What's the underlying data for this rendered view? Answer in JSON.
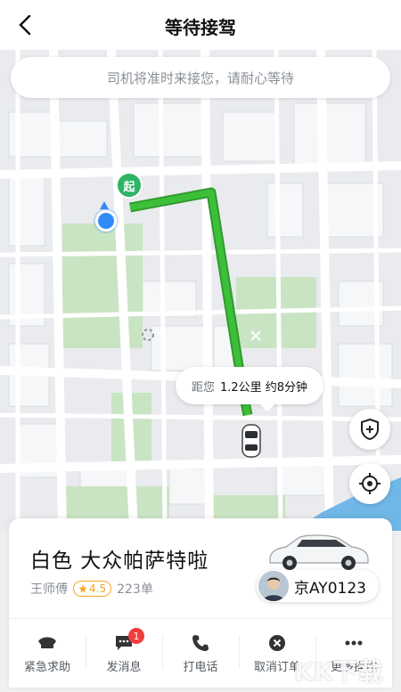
{
  "header": {
    "title": "等待接驾"
  },
  "map": {
    "notice": "司机将准时来接您，请耐心等待",
    "start_label": "起",
    "eta_bubble": {
      "prefix": "距您",
      "distance_time": "1.2公里 约8分钟"
    },
    "route_color": "#3dbf3a",
    "road_color": "#ffffff",
    "park_color": "#c9e4c3",
    "water_color": "#6fb7e6"
  },
  "car": {
    "name": "白色 大众帕萨特啦",
    "driver": "王师傅",
    "rating": "4.5",
    "orders": "223单",
    "plate": "京AY0123"
  },
  "actions": [
    {
      "icon": "police-hat-icon",
      "label": "紧急求助"
    },
    {
      "icon": "message-icon",
      "label": "发消息",
      "badge": "1"
    },
    {
      "icon": "phone-icon",
      "label": "打电话"
    },
    {
      "icon": "cancel-icon",
      "label": "取消订单"
    },
    {
      "icon": "more-icon",
      "label": "更多操作"
    }
  ],
  "watermark": {
    "text": "KK下载",
    "url": "www.kkx.net"
  }
}
